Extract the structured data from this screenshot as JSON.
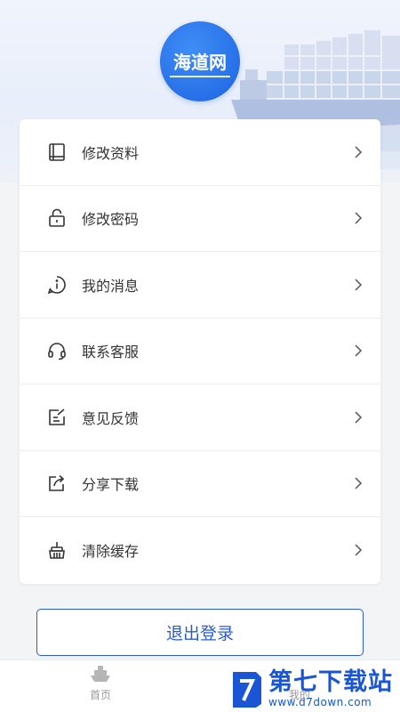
{
  "logo": {
    "text": "海道网"
  },
  "menu": {
    "items": [
      {
        "label": "修改资料",
        "icon": "book-icon"
      },
      {
        "label": "修改密码",
        "icon": "lock-icon"
      },
      {
        "label": "我的消息",
        "icon": "info-bubble-icon"
      },
      {
        "label": "联系客服",
        "icon": "headset-icon"
      },
      {
        "label": "意见反馈",
        "icon": "edit-note-icon"
      },
      {
        "label": "分享下载",
        "icon": "share-icon"
      },
      {
        "label": "清除缓存",
        "icon": "broom-icon"
      }
    ]
  },
  "logout": {
    "label": "退出登录"
  },
  "tabbar": {
    "home": {
      "label": "首页",
      "icon": "ship-icon"
    },
    "mine": {
      "label": "我的"
    }
  },
  "watermark": {
    "title": "第七下载站",
    "url": "www.d7down.com"
  },
  "colors": {
    "accent": "#2a5bd7",
    "background": "#f3f4f6",
    "card": "#ffffff"
  }
}
